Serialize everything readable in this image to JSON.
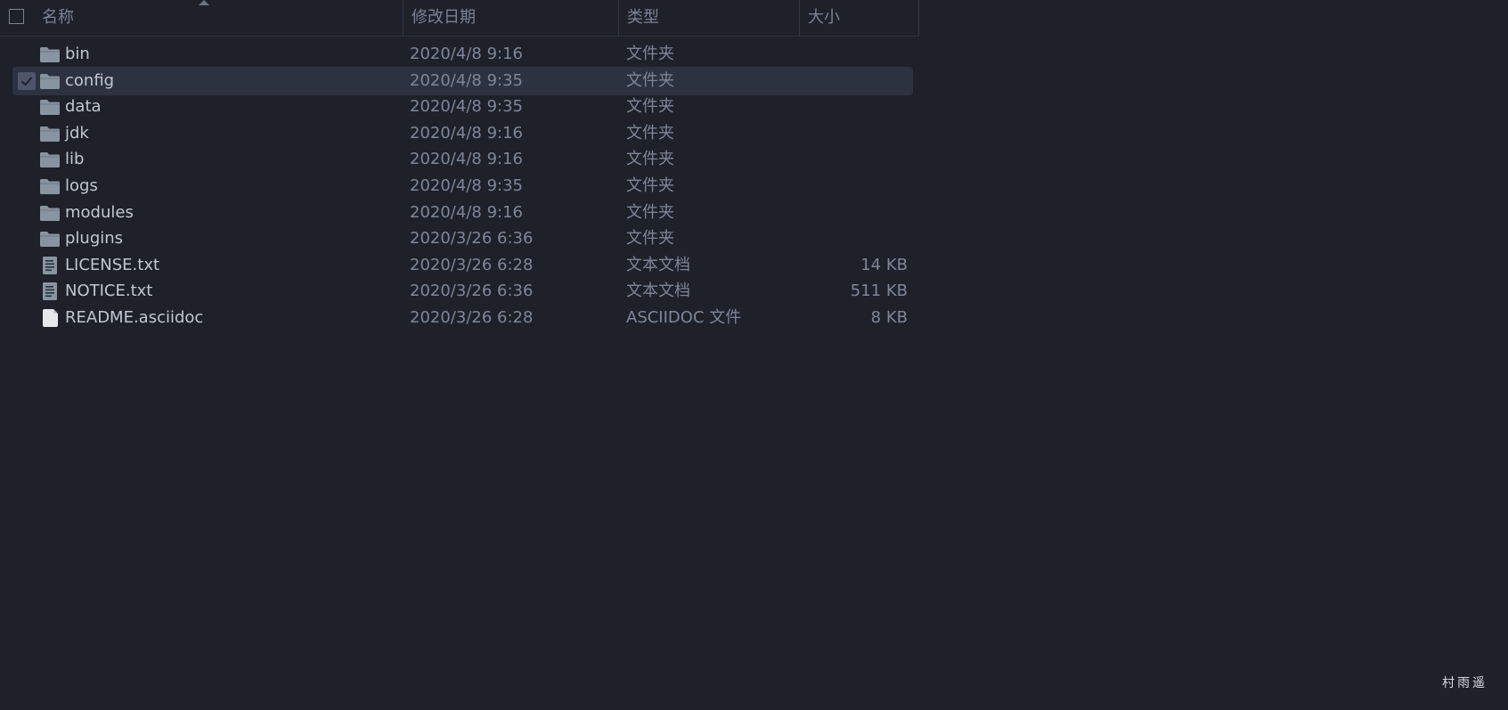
{
  "header": {
    "name_label": "名称",
    "date_label": "修改日期",
    "type_label": "类型",
    "size_label": "大小"
  },
  "files": [
    {
      "name": "bin",
      "date": "2020/4/8 9:16",
      "type": "文件夹",
      "size": "",
      "icon": "folder-icon",
      "selected": false
    },
    {
      "name": "config",
      "date": "2020/4/8 9:35",
      "type": "文件夹",
      "size": "",
      "icon": "folder-icon",
      "selected": true
    },
    {
      "name": "data",
      "date": "2020/4/8 9:35",
      "type": "文件夹",
      "size": "",
      "icon": "folder-icon",
      "selected": false
    },
    {
      "name": "jdk",
      "date": "2020/4/8 9:16",
      "type": "文件夹",
      "size": "",
      "icon": "folder-icon",
      "selected": false
    },
    {
      "name": "lib",
      "date": "2020/4/8 9:16",
      "type": "文件夹",
      "size": "",
      "icon": "folder-icon",
      "selected": false
    },
    {
      "name": "logs",
      "date": "2020/4/8 9:35",
      "type": "文件夹",
      "size": "",
      "icon": "folder-icon",
      "selected": false
    },
    {
      "name": "modules",
      "date": "2020/4/8 9:16",
      "type": "文件夹",
      "size": "",
      "icon": "folder-icon",
      "selected": false
    },
    {
      "name": "plugins",
      "date": "2020/3/26 6:36",
      "type": "文件夹",
      "size": "",
      "icon": "folder-icon",
      "selected": false
    },
    {
      "name": "LICENSE.txt",
      "date": "2020/3/26 6:28",
      "type": "文本文档",
      "size": "14 KB",
      "icon": "text-file-icon",
      "selected": false
    },
    {
      "name": "NOTICE.txt",
      "date": "2020/3/26 6:36",
      "type": "文本文档",
      "size": "511 KB",
      "icon": "text-file-icon",
      "selected": false
    },
    {
      "name": "README.asciidoc",
      "date": "2020/3/26 6:28",
      "type": "ASCIIDOC 文件",
      "size": "8 KB",
      "icon": "blank-file-icon",
      "selected": false
    }
  ],
  "watermark": "村雨遥",
  "colors": {
    "background": "#1e212a",
    "selected_row": "#2d3241",
    "folder": "#8895a0",
    "text_primary": "#c1c7d2",
    "text_secondary": "#7e8698"
  }
}
